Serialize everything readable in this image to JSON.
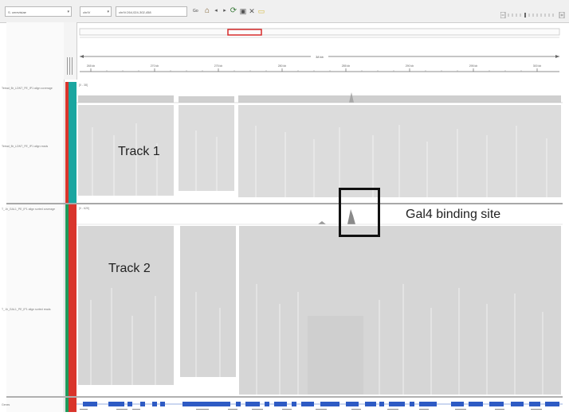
{
  "toolbar": {
    "genome": "S. cerevisiae",
    "chromosome": "chrIV",
    "locus": "chrIV:264,024-302,458",
    "go_label": "Go",
    "icons": [
      "home-icon",
      "back-arrow-icon",
      "forward-arrow-icon",
      "refresh-icon",
      "region-icon",
      "close-icon",
      "speech-bubble-icon"
    ]
  },
  "ruler": {
    "span_label": "38 kb",
    "ticks": [
      "265 kb",
      "270 kb",
      "275 kb",
      "280 kb",
      "285 kb",
      "290 kb",
      "295 kb",
      "300 kb"
    ]
  },
  "tracks": {
    "track1": {
      "coverage_name": "Tetrad_Br_LDNT_PE_IP1 align coverage",
      "reads_name": "Tetrad_Br_LDNT_PE_IP1 align reads",
      "range_label": "[0 - 38]",
      "overlay_label": "Track 1"
    },
    "track2": {
      "coverage_name": "T_1h_GAL1_PE_IP1 align sorted coverage",
      "reads_name": "T_1h_GAL1_PE_IP1 align sorted reads",
      "range_label": "[0 - 625]",
      "overlay_label": "Track 2"
    }
  },
  "annotation": {
    "binding_site_label": "Gal4 binding site"
  },
  "gene_track": {
    "name": "Genes"
  },
  "colors": {
    "read_gray": "#d0d0d0",
    "gene_blue": "#2e5bc4",
    "teal_strip": "#1aa6a0",
    "red_strip": "#d9352c",
    "green_strip": "#1f9a5a"
  }
}
